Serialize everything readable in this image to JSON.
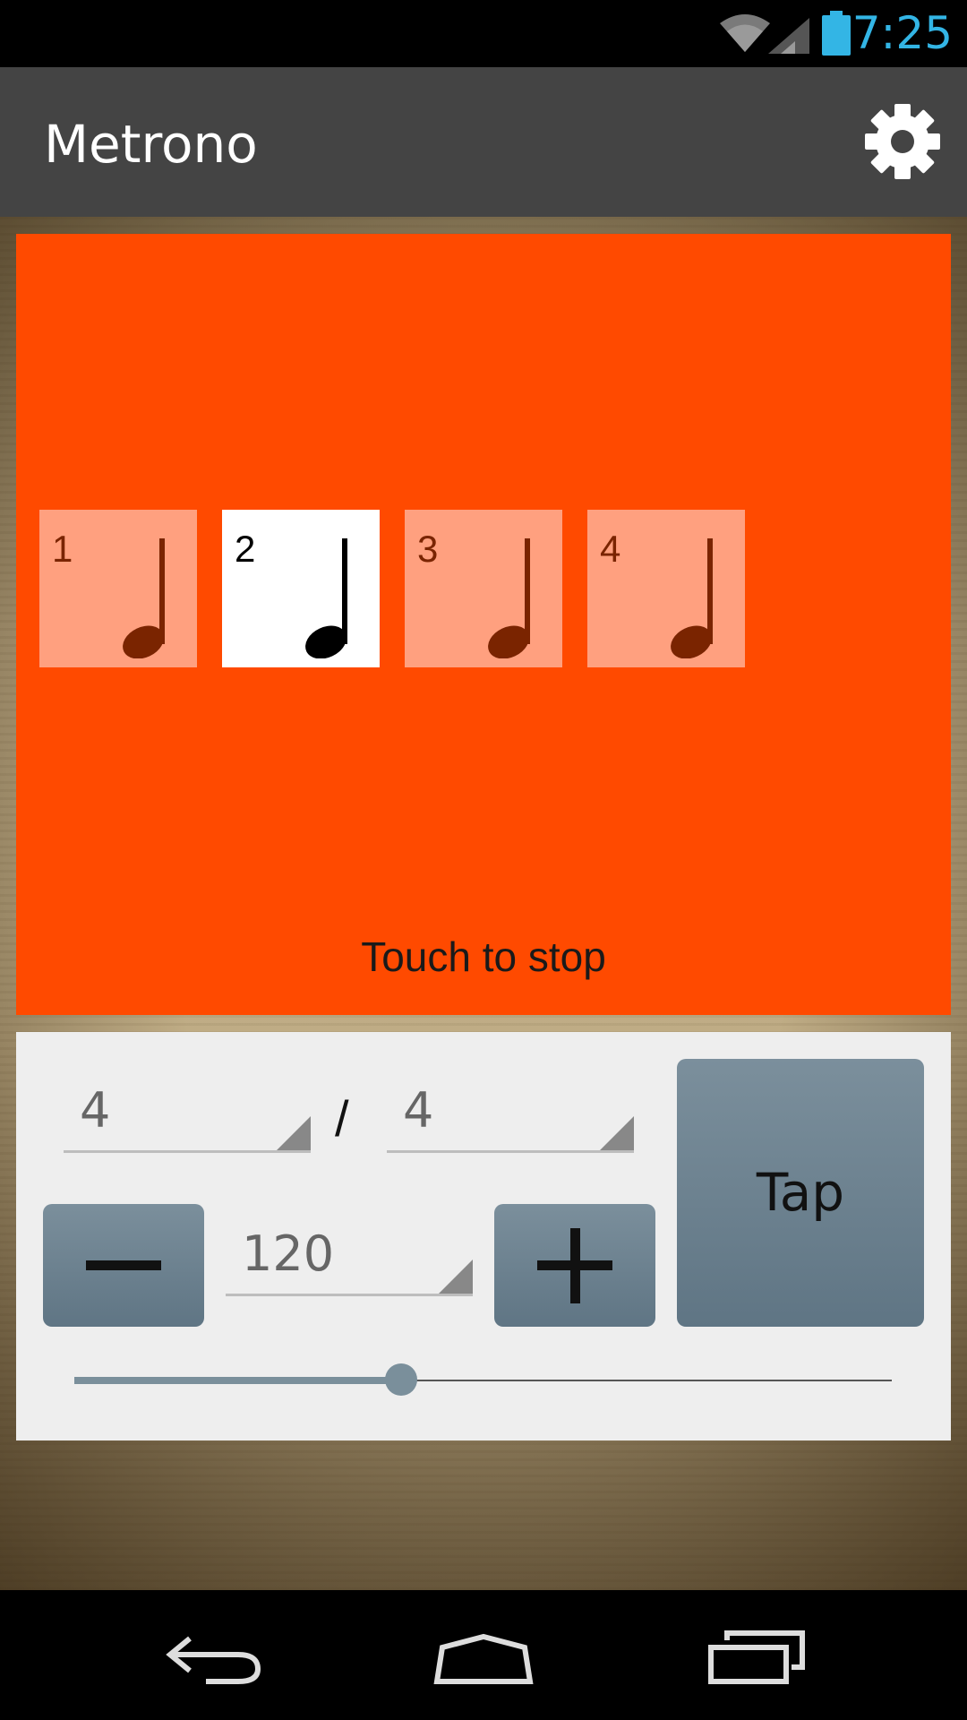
{
  "status_bar": {
    "time": "7:25",
    "icons": [
      "wifi-icon",
      "signal-icon",
      "battery-icon"
    ]
  },
  "action_bar": {
    "title": "Metrono",
    "settings_icon": "gear-icon"
  },
  "beat_panel": {
    "background": "#ff4a00",
    "beats": [
      {
        "number": "1",
        "active": false
      },
      {
        "number": "2",
        "active": true
      },
      {
        "number": "3",
        "active": false
      },
      {
        "number": "4",
        "active": false
      }
    ],
    "hint": "Touch to stop"
  },
  "controls": {
    "beats_per_measure": "4",
    "separator": "/",
    "note_value": "4",
    "tempo": "120",
    "decrease_icon": "minus-icon",
    "increase_icon": "plus-icon",
    "tap_label": "Tap",
    "tempo_slider_fraction": 0.4
  },
  "nav_bar": {
    "icons": [
      "back-icon",
      "home-icon",
      "recent-apps-icon"
    ]
  }
}
